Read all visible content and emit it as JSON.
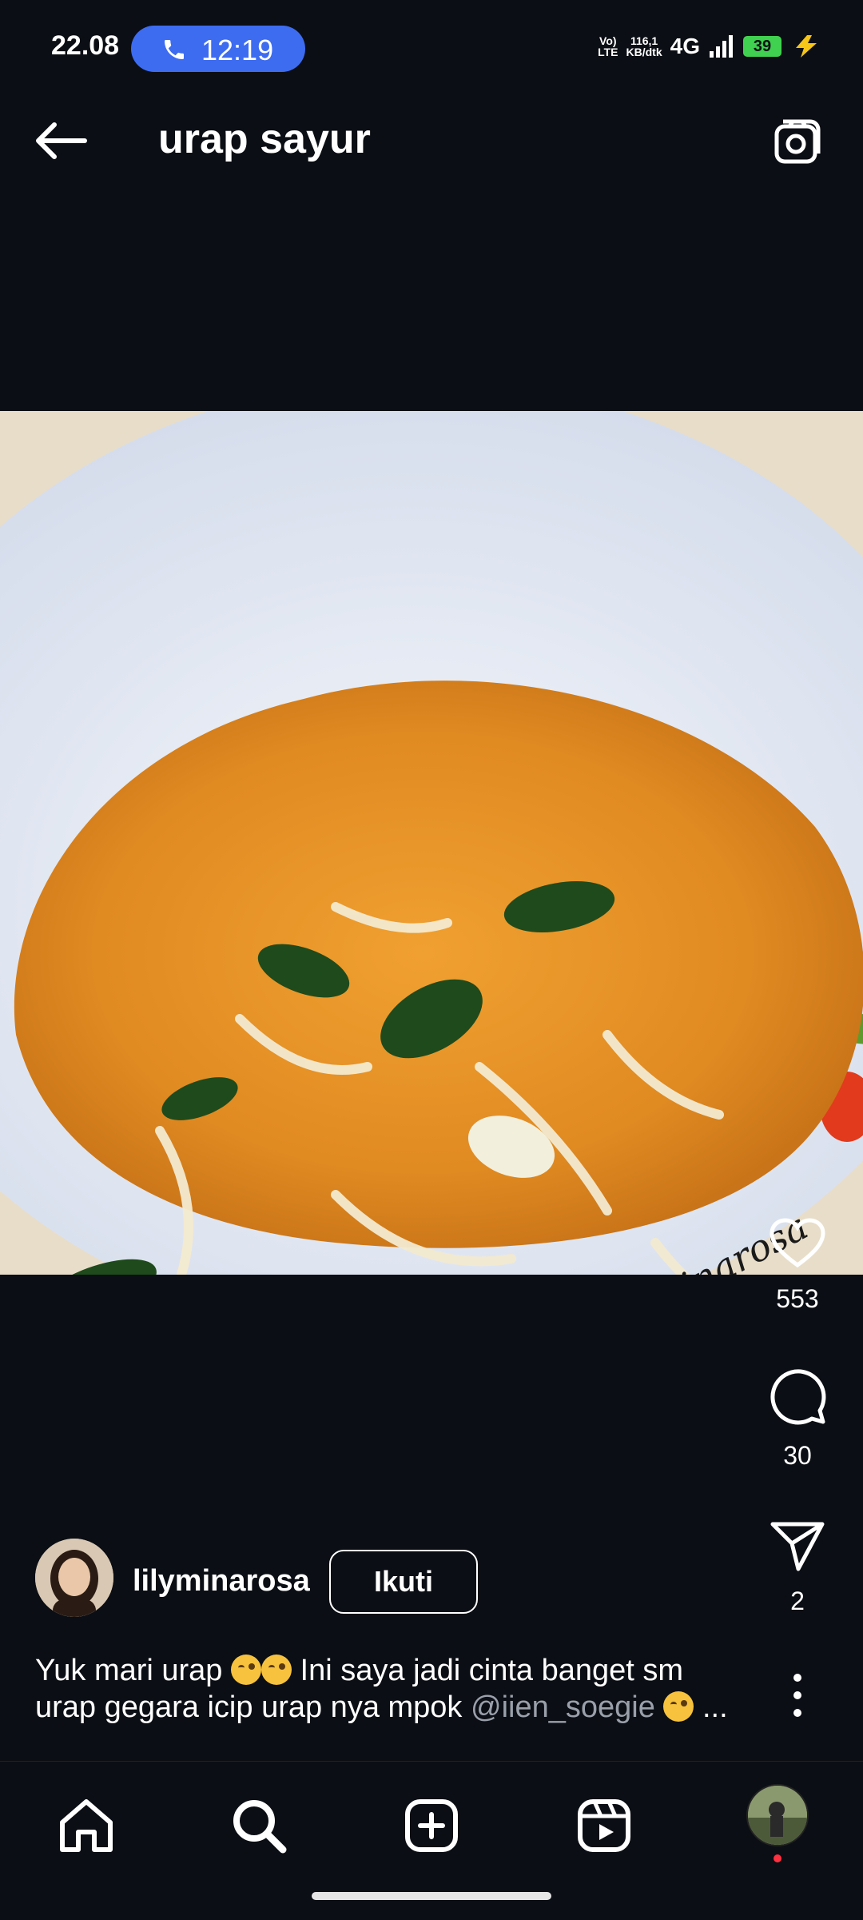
{
  "status_bar": {
    "time": "22.08",
    "call_time": "12:19",
    "volte_top": "Vo)",
    "volte_bottom": "LTE",
    "speed_top": "116,1",
    "speed_bottom": "KB/dtk",
    "network": "4G",
    "battery": "39"
  },
  "header": {
    "title": "urap sayur"
  },
  "post": {
    "watermark": "By Lily Minarosa",
    "likes": "553",
    "comments": "30",
    "shares": "2",
    "username": "lilyminarosa",
    "follow_label": "Ikuti",
    "caption_line1_a": "Yuk mari urap ",
    "caption_line1_b": " Ini saya jadi cinta banget sm",
    "caption_line2_a": "urap gegara icip urap nya mpok ",
    "caption_mention": "@iien_soegie",
    "caption_ellipsis": " ..."
  },
  "icons": {
    "back": "arrow-left-icon",
    "camera": "camera-icon",
    "like": "heart-icon",
    "comment": "comment-icon",
    "share": "send-icon",
    "more": "more-vertical-icon",
    "nav": [
      "home-icon",
      "search-icon",
      "add-icon",
      "reels-icon",
      "profile-avatar"
    ]
  },
  "colors": {
    "background": "#0b0e14",
    "call_pill": "#3d6cf0",
    "battery": "#3fd14f",
    "notification_dot": "#ff3040",
    "mention": "#9aa0aa"
  }
}
